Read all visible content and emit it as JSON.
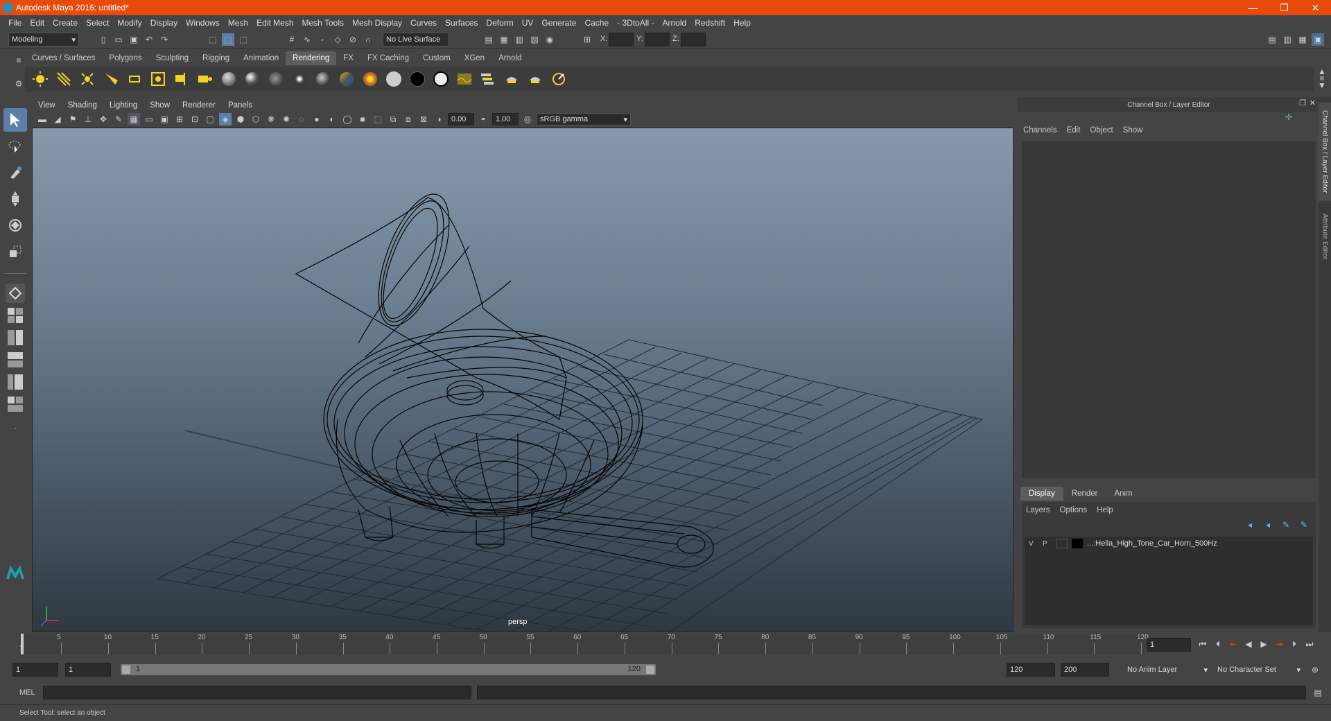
{
  "window": {
    "title": "Autodesk Maya 2016: untitled*",
    "minimize": "—",
    "restore": "❐",
    "close": "✕"
  },
  "menubar": [
    "File",
    "Edit",
    "Create",
    "Select",
    "Modify",
    "Display",
    "Windows",
    "Mesh",
    "Edit Mesh",
    "Mesh Tools",
    "Mesh Display",
    "Curves",
    "Surfaces",
    "Deform",
    "UV",
    "Generate",
    "Cache",
    "- 3DtoAll -",
    "Arnold",
    "Redshift",
    "Help"
  ],
  "statusline": {
    "mode": "Modeling",
    "live_surface": "No Live Surface",
    "x_label": "X:",
    "y_label": "Y:",
    "z_label": "Z:"
  },
  "shelf_tabs": [
    {
      "label": "Curves / Surfaces",
      "active": false
    },
    {
      "label": "Polygons",
      "active": false
    },
    {
      "label": "Sculpting",
      "active": false
    },
    {
      "label": "Rigging",
      "active": false
    },
    {
      "label": "Animation",
      "active": false
    },
    {
      "label": "Rendering",
      "active": true
    },
    {
      "label": "FX",
      "active": false
    },
    {
      "label": "FX Caching",
      "active": false
    },
    {
      "label": "Custom",
      "active": false
    },
    {
      "label": "XGen",
      "active": false
    },
    {
      "label": "Arnold",
      "active": false
    }
  ],
  "viewport": {
    "menu": [
      "View",
      "Shading",
      "Lighting",
      "Show",
      "Renderer",
      "Panels"
    ],
    "exposure": "0.00",
    "gamma": "1.00",
    "color_space": "sRGB gamma",
    "camera": "persp"
  },
  "channel_box": {
    "title": "Channel Box / Layer Editor",
    "menu": [
      "Channels",
      "Edit",
      "Object",
      "Show"
    ],
    "layer_tabs": [
      "Display",
      "Render",
      "Anim"
    ],
    "active_layer_tab": "Display",
    "layer_menu": [
      "Layers",
      "Options",
      "Help"
    ],
    "layer": {
      "v": "V",
      "p": "P",
      "name": "...:Hella_High_Tone_Car_Horn_500Hz"
    }
  },
  "side_tabs": [
    "Channel Box / Layer Editor",
    "Attribute Editor"
  ],
  "timeline": {
    "ticks": [
      "5",
      "10",
      "15",
      "20",
      "25",
      "30",
      "35",
      "40",
      "45",
      "50",
      "55",
      "60",
      "65",
      "70",
      "75",
      "80",
      "85",
      "90",
      "95",
      "100",
      "105",
      "110",
      "115",
      "120"
    ],
    "start": "1",
    "current_frame": "1"
  },
  "range": {
    "start": "1",
    "playback_start": "1",
    "slider_start": "1",
    "slider_end": "120",
    "playback_end": "120",
    "end": "200",
    "anim_layer": "No Anim Layer",
    "char_set": "No Character Set"
  },
  "command": {
    "label": "MEL"
  },
  "help_line": "Select Tool: select an object",
  "colors": {
    "title_bar": "#e84a0c",
    "accent": "#5d5d5d",
    "viewport_top": "#8699ac",
    "viewport_bottom": "#2f3840"
  }
}
